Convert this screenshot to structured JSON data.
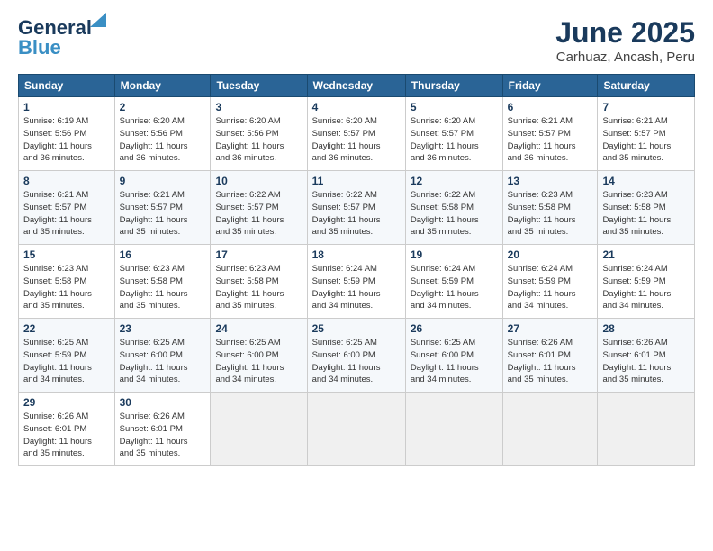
{
  "logo": {
    "line1": "General",
    "line2": "Blue"
  },
  "title": "June 2025",
  "subtitle": "Carhuaz, Ancash, Peru",
  "headers": [
    "Sunday",
    "Monday",
    "Tuesday",
    "Wednesday",
    "Thursday",
    "Friday",
    "Saturday"
  ],
  "weeks": [
    [
      {
        "num": "1",
        "info": "Sunrise: 6:19 AM\nSunset: 5:56 PM\nDaylight: 11 hours\nand 36 minutes."
      },
      {
        "num": "2",
        "info": "Sunrise: 6:20 AM\nSunset: 5:56 PM\nDaylight: 11 hours\nand 36 minutes."
      },
      {
        "num": "3",
        "info": "Sunrise: 6:20 AM\nSunset: 5:56 PM\nDaylight: 11 hours\nand 36 minutes."
      },
      {
        "num": "4",
        "info": "Sunrise: 6:20 AM\nSunset: 5:57 PM\nDaylight: 11 hours\nand 36 minutes."
      },
      {
        "num": "5",
        "info": "Sunrise: 6:20 AM\nSunset: 5:57 PM\nDaylight: 11 hours\nand 36 minutes."
      },
      {
        "num": "6",
        "info": "Sunrise: 6:21 AM\nSunset: 5:57 PM\nDaylight: 11 hours\nand 36 minutes."
      },
      {
        "num": "7",
        "info": "Sunrise: 6:21 AM\nSunset: 5:57 PM\nDaylight: 11 hours\nand 35 minutes."
      }
    ],
    [
      {
        "num": "8",
        "info": "Sunrise: 6:21 AM\nSunset: 5:57 PM\nDaylight: 11 hours\nand 35 minutes."
      },
      {
        "num": "9",
        "info": "Sunrise: 6:21 AM\nSunset: 5:57 PM\nDaylight: 11 hours\nand 35 minutes."
      },
      {
        "num": "10",
        "info": "Sunrise: 6:22 AM\nSunset: 5:57 PM\nDaylight: 11 hours\nand 35 minutes."
      },
      {
        "num": "11",
        "info": "Sunrise: 6:22 AM\nSunset: 5:57 PM\nDaylight: 11 hours\nand 35 minutes."
      },
      {
        "num": "12",
        "info": "Sunrise: 6:22 AM\nSunset: 5:58 PM\nDaylight: 11 hours\nand 35 minutes."
      },
      {
        "num": "13",
        "info": "Sunrise: 6:23 AM\nSunset: 5:58 PM\nDaylight: 11 hours\nand 35 minutes."
      },
      {
        "num": "14",
        "info": "Sunrise: 6:23 AM\nSunset: 5:58 PM\nDaylight: 11 hours\nand 35 minutes."
      }
    ],
    [
      {
        "num": "15",
        "info": "Sunrise: 6:23 AM\nSunset: 5:58 PM\nDaylight: 11 hours\nand 35 minutes."
      },
      {
        "num": "16",
        "info": "Sunrise: 6:23 AM\nSunset: 5:58 PM\nDaylight: 11 hours\nand 35 minutes."
      },
      {
        "num": "17",
        "info": "Sunrise: 6:23 AM\nSunset: 5:58 PM\nDaylight: 11 hours\nand 35 minutes."
      },
      {
        "num": "18",
        "info": "Sunrise: 6:24 AM\nSunset: 5:59 PM\nDaylight: 11 hours\nand 34 minutes."
      },
      {
        "num": "19",
        "info": "Sunrise: 6:24 AM\nSunset: 5:59 PM\nDaylight: 11 hours\nand 34 minutes."
      },
      {
        "num": "20",
        "info": "Sunrise: 6:24 AM\nSunset: 5:59 PM\nDaylight: 11 hours\nand 34 minutes."
      },
      {
        "num": "21",
        "info": "Sunrise: 6:24 AM\nSunset: 5:59 PM\nDaylight: 11 hours\nand 34 minutes."
      }
    ],
    [
      {
        "num": "22",
        "info": "Sunrise: 6:25 AM\nSunset: 5:59 PM\nDaylight: 11 hours\nand 34 minutes."
      },
      {
        "num": "23",
        "info": "Sunrise: 6:25 AM\nSunset: 6:00 PM\nDaylight: 11 hours\nand 34 minutes."
      },
      {
        "num": "24",
        "info": "Sunrise: 6:25 AM\nSunset: 6:00 PM\nDaylight: 11 hours\nand 34 minutes."
      },
      {
        "num": "25",
        "info": "Sunrise: 6:25 AM\nSunset: 6:00 PM\nDaylight: 11 hours\nand 34 minutes."
      },
      {
        "num": "26",
        "info": "Sunrise: 6:25 AM\nSunset: 6:00 PM\nDaylight: 11 hours\nand 34 minutes."
      },
      {
        "num": "27",
        "info": "Sunrise: 6:26 AM\nSunset: 6:01 PM\nDaylight: 11 hours\nand 35 minutes."
      },
      {
        "num": "28",
        "info": "Sunrise: 6:26 AM\nSunset: 6:01 PM\nDaylight: 11 hours\nand 35 minutes."
      }
    ],
    [
      {
        "num": "29",
        "info": "Sunrise: 6:26 AM\nSunset: 6:01 PM\nDaylight: 11 hours\nand 35 minutes."
      },
      {
        "num": "30",
        "info": "Sunrise: 6:26 AM\nSunset: 6:01 PM\nDaylight: 11 hours\nand 35 minutes."
      },
      null,
      null,
      null,
      null,
      null
    ]
  ]
}
